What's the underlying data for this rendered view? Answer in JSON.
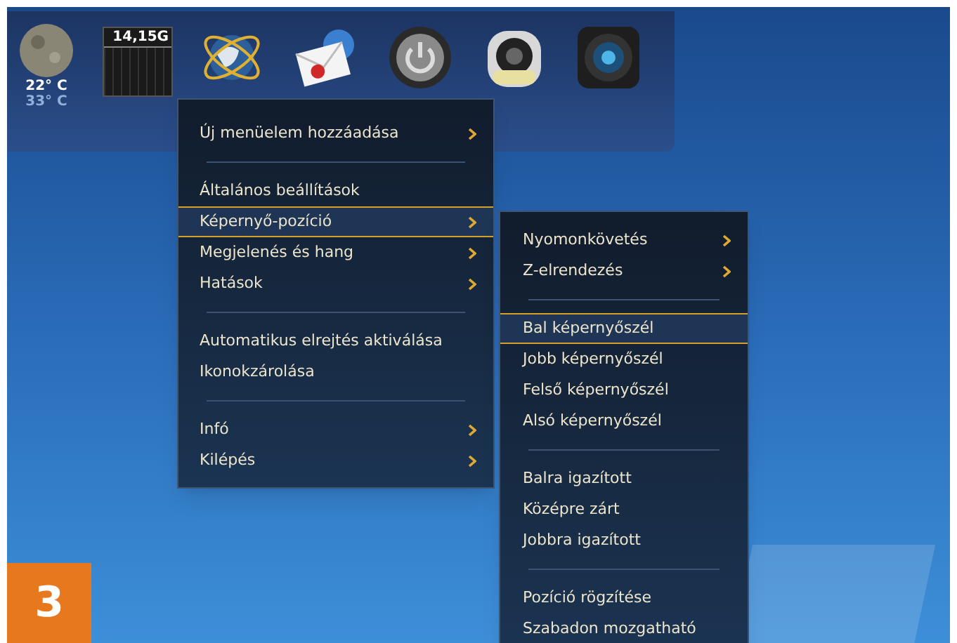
{
  "dock": {
    "weather": {
      "temperature": "22° C",
      "secondary_temperature": "33° C"
    },
    "disk_meter": {
      "reading": "14,15G"
    },
    "icons": [
      {
        "kind": "globe"
      },
      {
        "kind": "mail"
      },
      {
        "kind": "power"
      },
      {
        "kind": "speaker"
      },
      {
        "kind": "camera"
      }
    ]
  },
  "main_menu": {
    "items": [
      {
        "kind": "item",
        "label": "Új menüelem hozzáadása",
        "submenu": true,
        "selected": false
      },
      {
        "kind": "separator"
      },
      {
        "kind": "item",
        "label": "Általános beállítások",
        "submenu": false,
        "selected": false
      },
      {
        "kind": "item",
        "label": "Képernyő-pozíció",
        "submenu": true,
        "selected": true
      },
      {
        "kind": "item",
        "label": "Megjelenés és hang",
        "submenu": true,
        "selected": false
      },
      {
        "kind": "item",
        "label": "Hatások",
        "submenu": true,
        "selected": false
      },
      {
        "kind": "separator"
      },
      {
        "kind": "item",
        "label": "Automatikus elrejtés aktiválása",
        "submenu": false,
        "selected": false
      },
      {
        "kind": "item",
        "label": "Ikonokzárolása",
        "submenu": false,
        "selected": false
      },
      {
        "kind": "separator"
      },
      {
        "kind": "item",
        "label": "Infó",
        "submenu": true,
        "selected": false
      },
      {
        "kind": "item",
        "label": "Kilépés",
        "submenu": true,
        "selected": false
      }
    ]
  },
  "submenu": {
    "items": [
      {
        "kind": "item",
        "label": "Nyomonkövetés",
        "submenu": true,
        "selected": false
      },
      {
        "kind": "item",
        "label": "Z-elrendezés",
        "submenu": true,
        "selected": false
      },
      {
        "kind": "separator"
      },
      {
        "kind": "item",
        "label": "Bal képernyőszél",
        "submenu": false,
        "selected": true
      },
      {
        "kind": "item",
        "label": "Jobb képernyőszél",
        "submenu": false,
        "selected": false
      },
      {
        "kind": "item",
        "label": "Felső képernyőszél",
        "submenu": false,
        "selected": false
      },
      {
        "kind": "item",
        "label": "Alsó képernyőszél",
        "submenu": false,
        "selected": false
      },
      {
        "kind": "separator"
      },
      {
        "kind": "item",
        "label": "Balra igazított",
        "submenu": false,
        "selected": false
      },
      {
        "kind": "item",
        "label": "Középre zárt",
        "submenu": false,
        "selected": false
      },
      {
        "kind": "item",
        "label": "Jobbra igazított",
        "submenu": false,
        "selected": false
      },
      {
        "kind": "separator"
      },
      {
        "kind": "item",
        "label": "Pozíció rögzítése",
        "submenu": false,
        "selected": false
      },
      {
        "kind": "item",
        "label": "Szabadon mozgatható",
        "submenu": false,
        "selected": false
      }
    ]
  },
  "figure_badge": "3"
}
